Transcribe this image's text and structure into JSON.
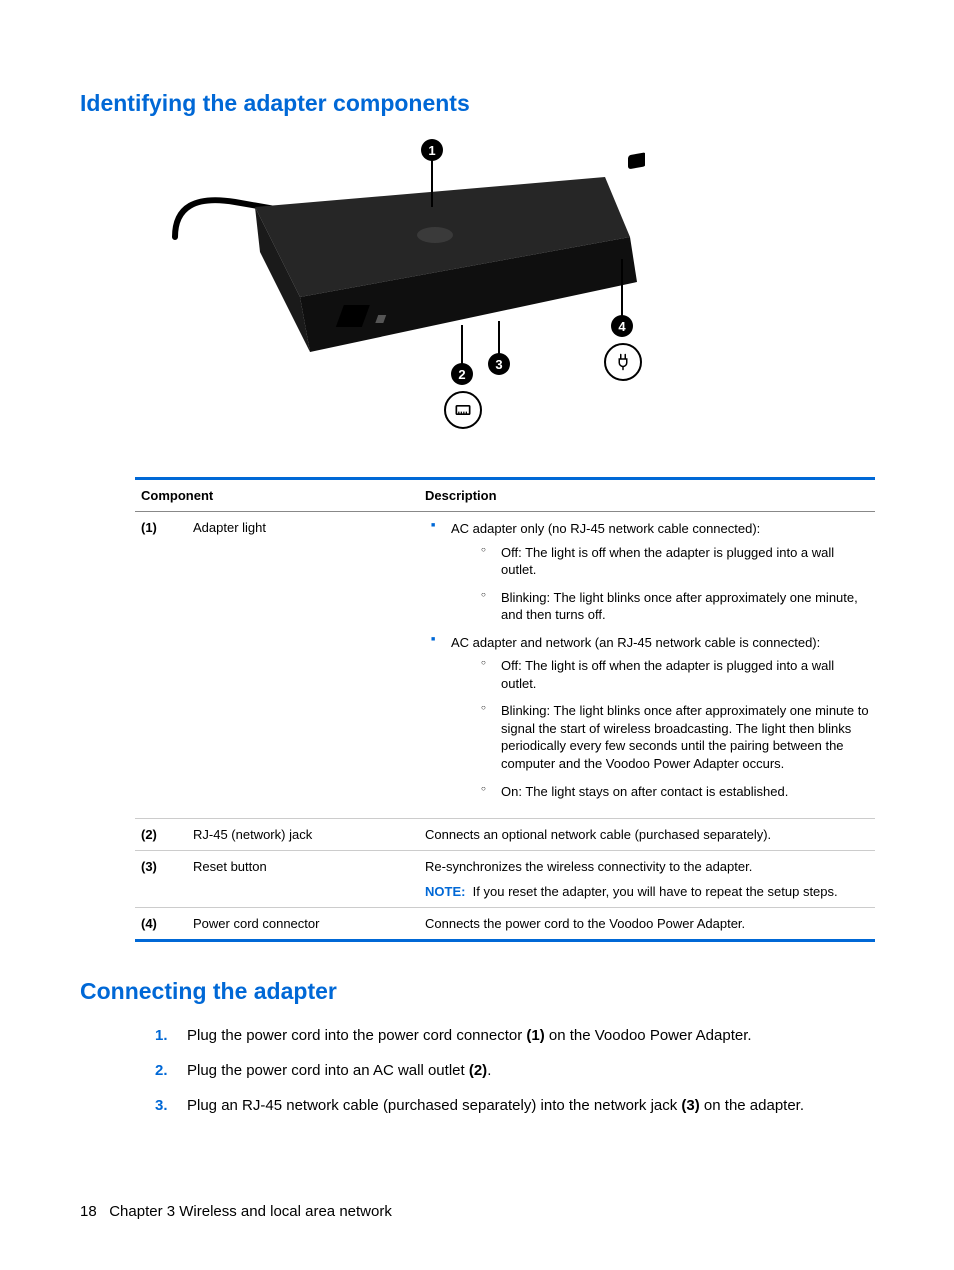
{
  "heading1": "Identifying the adapter components",
  "heading2": "Connecting the adapter",
  "diagram": {
    "callouts": [
      "1",
      "2",
      "3",
      "4"
    ],
    "icons": {
      "rj45": "rj45-icon",
      "plug": "plug-icon"
    }
  },
  "table": {
    "headers": {
      "component": "Component",
      "description": "Description"
    },
    "rows": [
      {
        "num": "(1)",
        "name": "Adapter light",
        "desc": {
          "type": "nested",
          "bullets": [
            {
              "text": "AC adapter only (no RJ-45 network cable connected):",
              "sub": [
                "Off: The light is off when the adapter is plugged into a wall outlet.",
                "Blinking: The light blinks once after approximately one minute, and then turns off."
              ]
            },
            {
              "text": "AC adapter and network (an RJ-45 network cable is connected):",
              "sub": [
                "Off: The light is off when the adapter is plugged into a wall outlet.",
                "Blinking: The light blinks once after approximately one minute to signal the start of wireless broadcasting. The light then blinks periodically every few seconds until the pairing between the computer and the Voodoo Power Adapter occurs.",
                "On: The light stays on after contact is established."
              ]
            }
          ]
        }
      },
      {
        "num": "(2)",
        "name": "RJ-45 (network) jack",
        "desc": {
          "type": "plain",
          "text": "Connects an optional network cable (purchased separately)."
        }
      },
      {
        "num": "(3)",
        "name": "Reset button",
        "desc": {
          "type": "note",
          "text": "Re-synchronizes the wireless connectivity to the adapter.",
          "note_label": "NOTE:",
          "note_text": "If you reset the adapter, you will have to repeat the setup steps."
        }
      },
      {
        "num": "(4)",
        "name": "Power cord connector",
        "desc": {
          "type": "plain",
          "text": "Connects the power cord to the Voodoo Power Adapter."
        }
      }
    ]
  },
  "steps": [
    {
      "num": "1.",
      "html": "Plug the power cord into the power cord connector <b>(1)</b> on the Voodoo Power Adapter."
    },
    {
      "num": "2.",
      "html": "Plug the power cord into an AC wall outlet <b>(2)</b>."
    },
    {
      "num": "3.",
      "html": "Plug an RJ-45 network cable (purchased separately) into the network jack <b>(3)</b> on the adapter."
    }
  ],
  "footer": {
    "page": "18",
    "chapter": "Chapter 3   Wireless and local area network"
  }
}
